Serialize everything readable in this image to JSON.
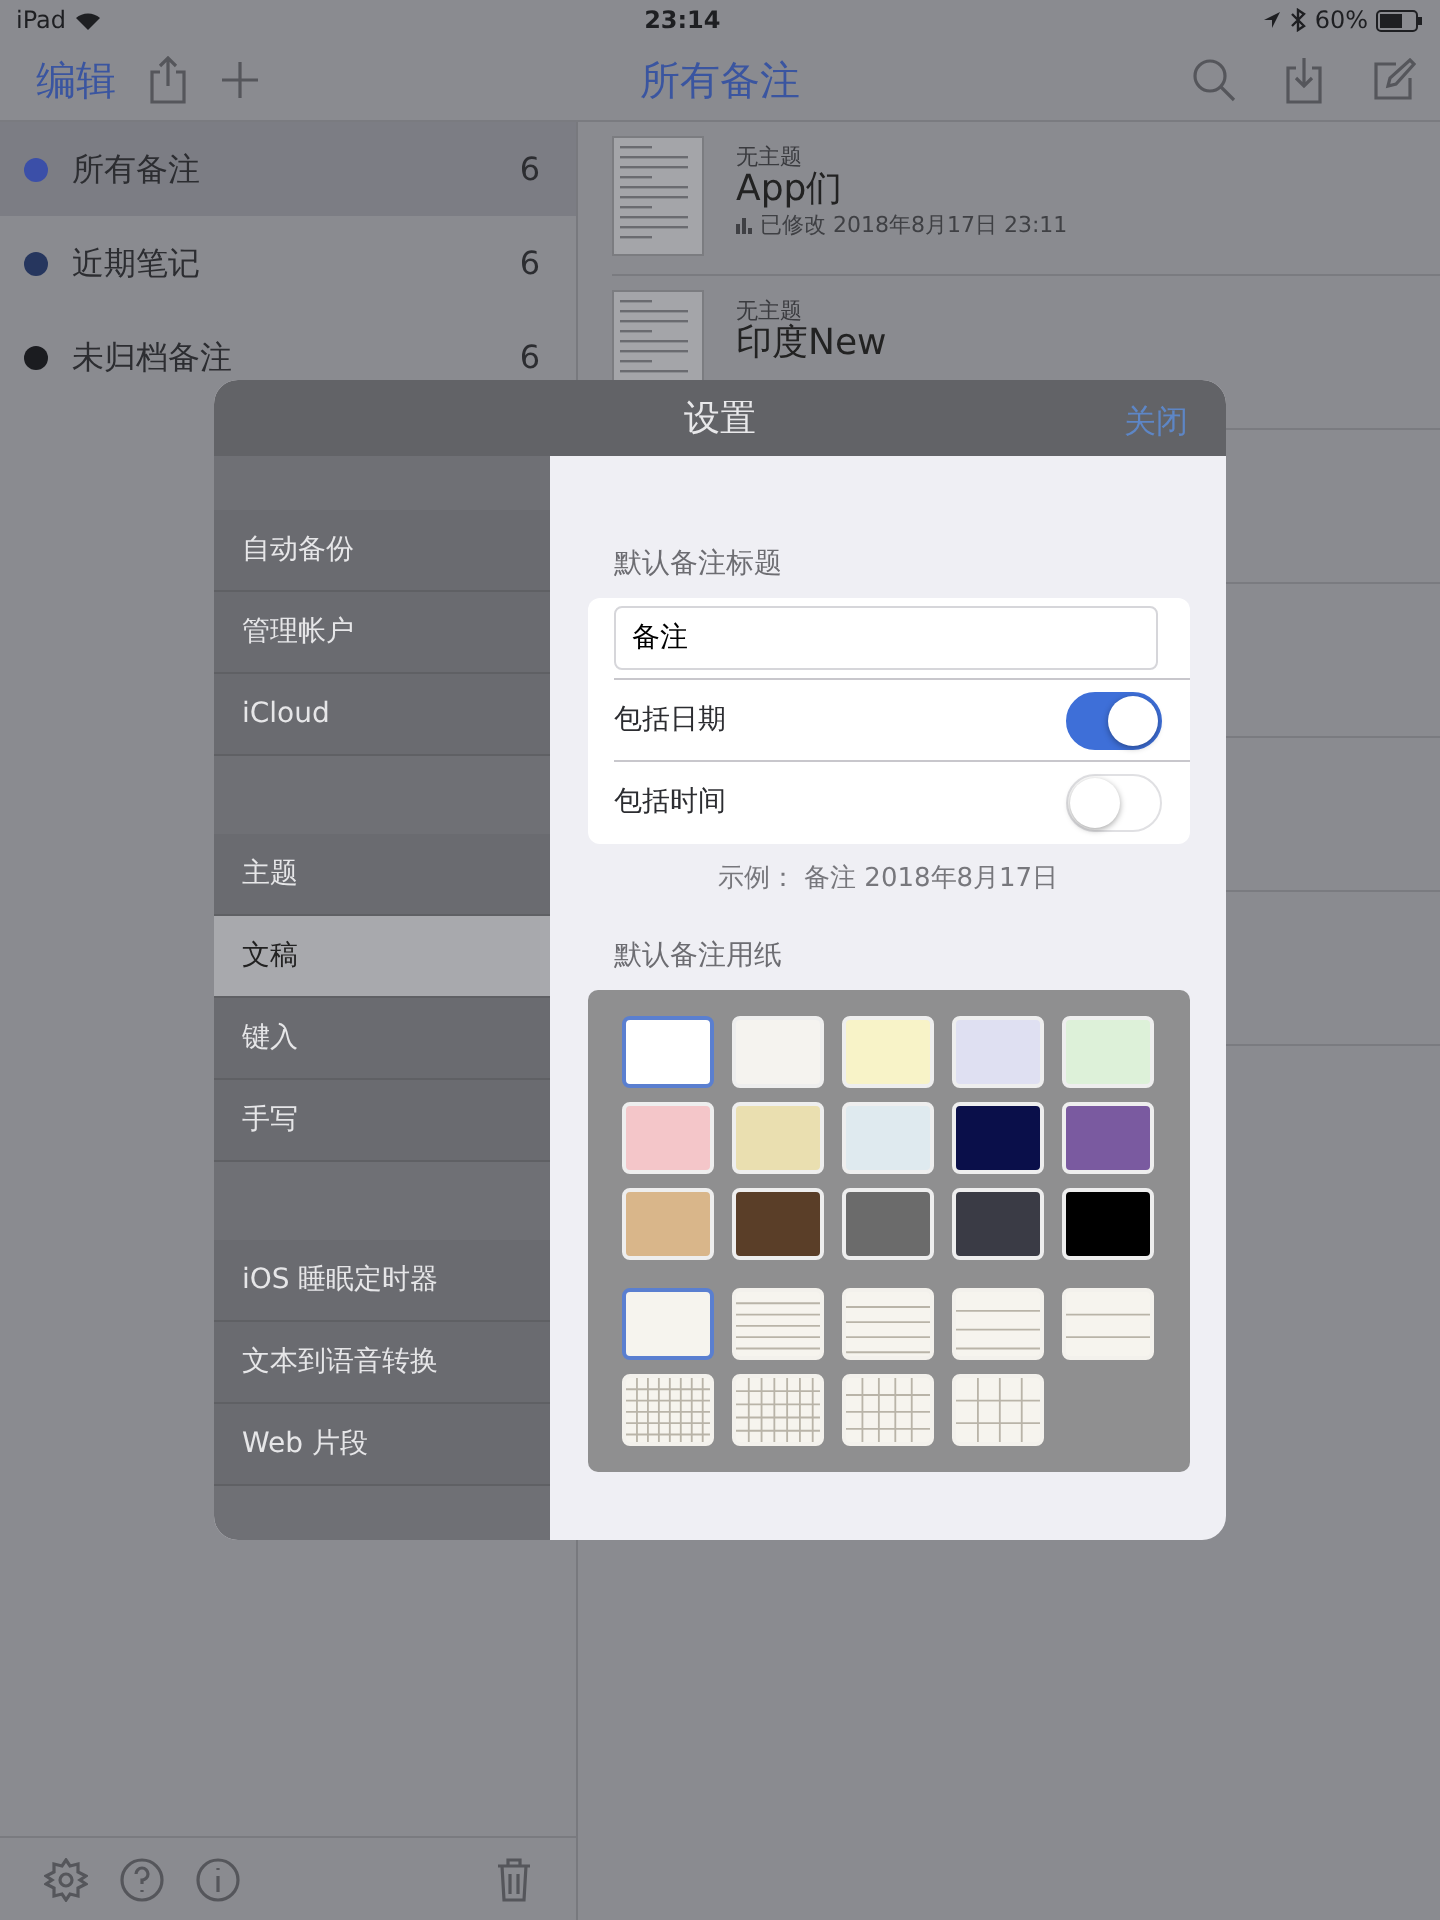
{
  "status_bar": {
    "device": "iPad",
    "time": "23:14",
    "battery": "60%"
  },
  "nav": {
    "edit": "编辑",
    "title": "所有备注"
  },
  "sidebar": {
    "items": [
      {
        "label": "所有备注",
        "count": "6",
        "color": "#3b4fa8",
        "selected": true
      },
      {
        "label": "近期笔记",
        "count": "6",
        "color": "#26365e",
        "selected": false
      },
      {
        "label": "未归档备注",
        "count": "6",
        "color": "#1b1c20",
        "selected": false
      }
    ]
  },
  "notes": [
    {
      "subtitle": "无主题",
      "title": "App们",
      "modified": "已修改 2018年8月17日 23:11"
    },
    {
      "subtitle": "无主题",
      "title": "印度New"
    }
  ],
  "settings": {
    "title": "设置",
    "close": "关闭",
    "menu_groups": [
      {
        "items": [
          {
            "label": "自动备份",
            "selected": false
          },
          {
            "label": "管理帐户",
            "selected": false
          },
          {
            "label": "iCloud",
            "selected": false
          }
        ]
      },
      {
        "items": [
          {
            "label": "主题",
            "selected": false
          },
          {
            "label": "文稿",
            "selected": true
          },
          {
            "label": "键入",
            "selected": false
          },
          {
            "label": "手写",
            "selected": false
          }
        ]
      },
      {
        "items": [
          {
            "label": "iOS 睡眠定时器",
            "selected": false
          },
          {
            "label": "文本到语音转换",
            "selected": false
          },
          {
            "label": "Web 片段",
            "selected": false
          }
        ]
      }
    ],
    "title_section": {
      "label": "默认备注标题",
      "value": "备注",
      "toggles": [
        {
          "label": "包括日期",
          "on": true
        },
        {
          "label": "包括时间",
          "on": false
        }
      ],
      "example": "示例： 备注 2018年8月17日"
    },
    "paper_section": {
      "label": "默认备注用纸",
      "colors": [
        {
          "color": "#ffffff",
          "selected": true
        },
        {
          "color": "#f5f3ef",
          "selected": false
        },
        {
          "color": "#f8f3c8",
          "selected": false
        },
        {
          "color": "#dfe0f2",
          "selected": false
        },
        {
          "color": "#ddf1d9",
          "selected": false
        },
        {
          "color": "#f4c6c9",
          "selected": false
        },
        {
          "color": "#eadfb0",
          "selected": false
        },
        {
          "color": "#dfeaef",
          "selected": false
        },
        {
          "color": "#0a0f4a",
          "selected": false
        },
        {
          "color": "#7a5aa0",
          "selected": false
        },
        {
          "color": "#d9b68a",
          "selected": false
        },
        {
          "color": "#5a3e28",
          "selected": false
        },
        {
          "color": "#6b6b6b",
          "selected": false
        },
        {
          "color": "#3a3b45",
          "selected": false
        },
        {
          "color": "#000000",
          "selected": false
        }
      ],
      "styles": [
        {
          "kind": "plain",
          "selected": true
        },
        {
          "kind": "lined",
          "selected": false
        },
        {
          "kind": "lined",
          "selected": false
        },
        {
          "kind": "lined",
          "selected": false
        },
        {
          "kind": "lined",
          "selected": false
        },
        {
          "kind": "grid",
          "selected": false
        },
        {
          "kind": "grid",
          "selected": false
        },
        {
          "kind": "grid",
          "selected": false
        },
        {
          "kind": "grid",
          "selected": false
        }
      ]
    }
  }
}
